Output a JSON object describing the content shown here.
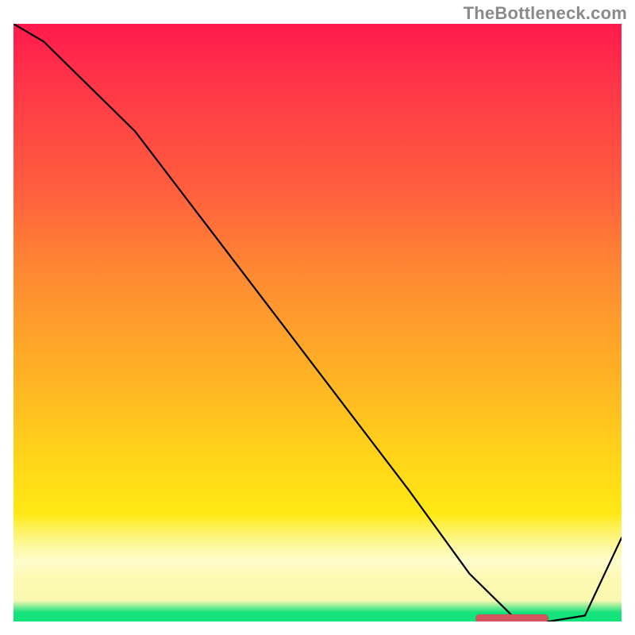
{
  "attribution": "TheBottleneck.com",
  "colors": {
    "gradient_top": "#ff1a4d",
    "gradient_mid": "#ffd31a",
    "gradient_bottom": "#14e27a",
    "curve": "#000000",
    "marker": "#d1555c"
  },
  "chart_data": {
    "type": "line",
    "title": "",
    "xlabel": "",
    "ylabel": "",
    "xlim": [
      0,
      100
    ],
    "ylim": [
      0,
      100
    ],
    "x": [
      0,
      5,
      20,
      35,
      50,
      65,
      75,
      82,
      88,
      94,
      100
    ],
    "values": [
      100,
      97,
      82,
      62,
      42,
      22,
      8,
      1,
      0,
      1,
      14
    ],
    "marker_segment": {
      "x_start": 76,
      "x_end": 88,
      "y": 0.5
    },
    "notes": "Axes are unlabeled in the source image; values normalized 0–100 in both directions and read off by proportion."
  }
}
